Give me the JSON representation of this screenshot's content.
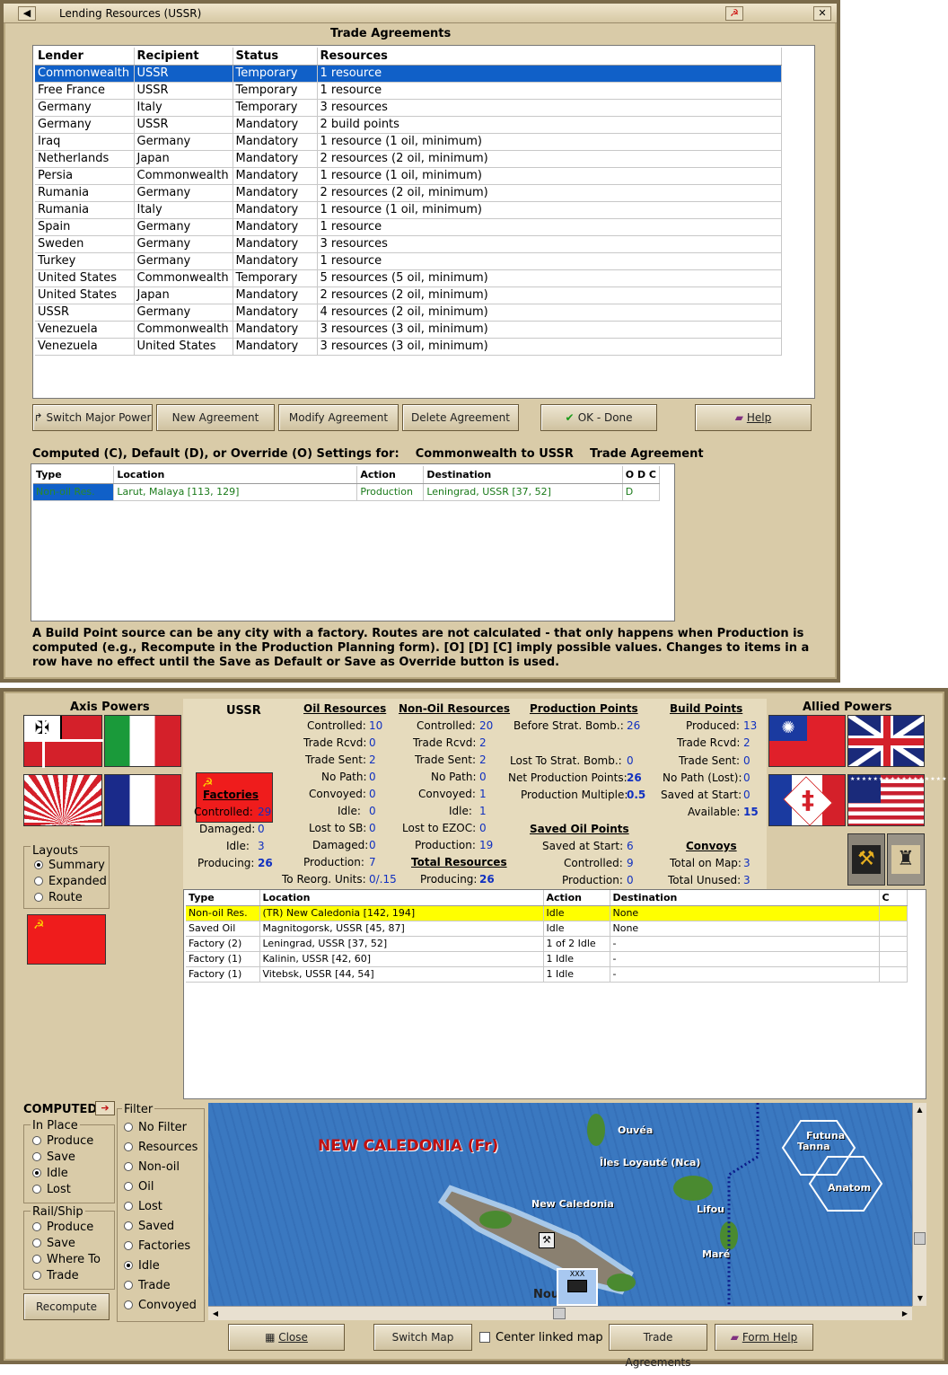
{
  "top_window": {
    "title": "Lending Resources (USSR)",
    "heading": "Trade Agreements",
    "columns": [
      "Lender",
      "Recipient",
      "Status",
      "Resources"
    ],
    "rows": [
      [
        "Commonwealth",
        "USSR",
        "Temporary",
        "1 resource"
      ],
      [
        "Free France",
        "USSR",
        "Temporary",
        "1 resource"
      ],
      [
        "Germany",
        "Italy",
        "Temporary",
        "3 resources"
      ],
      [
        "Germany",
        "USSR",
        "Mandatory",
        "2 build points"
      ],
      [
        "Iraq",
        "Germany",
        "Mandatory",
        "1 resource (1 oil, minimum)"
      ],
      [
        "Netherlands",
        "Japan",
        "Mandatory",
        "2 resources (2 oil, minimum)"
      ],
      [
        "Persia",
        "Commonwealth",
        "Mandatory",
        "1 resource (1 oil, minimum)"
      ],
      [
        "Rumania",
        "Germany",
        "Mandatory",
        "2 resources (2 oil, minimum)"
      ],
      [
        "Rumania",
        "Italy",
        "Mandatory",
        "1 resource (1 oil, minimum)"
      ],
      [
        "Spain",
        "Germany",
        "Mandatory",
        "1 resource"
      ],
      [
        "Sweden",
        "Germany",
        "Mandatory",
        "3 resources"
      ],
      [
        "Turkey",
        "Germany",
        "Mandatory",
        "1 resource"
      ],
      [
        "United States",
        "Commonwealth",
        "Temporary",
        "5 resources (5 oil, minimum)"
      ],
      [
        "United States",
        "Japan",
        "Mandatory",
        "2 resources (2 oil, minimum)"
      ],
      [
        "USSR",
        "Germany",
        "Mandatory",
        "4 resources (2 oil, minimum)"
      ],
      [
        "Venezuela",
        "Commonwealth",
        "Mandatory",
        "3 resources (3 oil, minimum)"
      ],
      [
        "Venezuela",
        "United States",
        "Mandatory",
        "3 resources (3 oil, minimum)"
      ]
    ],
    "buttons": {
      "switch": "Switch Major Power",
      "new": "New Agreement",
      "modify": "Modify Agreement",
      "delete": "Delete Agreement",
      "ok": "OK - Done",
      "help": "Help"
    },
    "settings_heading": "Computed (C), Default (D), or Override (O) Settings for:",
    "settings_subject": "Commonwealth to USSR",
    "settings_suffix": "Trade Agreement",
    "route_columns": [
      "Type",
      "Location",
      "Action",
      "Destination",
      "O D C"
    ],
    "route_row": [
      "Non-oil Res.",
      "Larut, Malaya [113, 129]",
      "Production",
      "Leningrad, USSR [37, 52]",
      "D"
    ],
    "note": "A Build Point source can be any city with a factory. Routes are not calculated - that only happens when Production is computed (e.g., Recompute in the Production Planning form).  [O] [D] [C] imply possible values.  Changes to items in a row have no effect until the Save as Default or Save as Override button is used."
  },
  "bottom_window": {
    "axis_label": "Axis Powers",
    "allied_label": "Allied Powers",
    "country": "USSR",
    "factories": {
      "title": "Factories",
      "controlled_l": "Controlled:",
      "controlled": "29",
      "damaged_l": "Damaged:",
      "damaged": "0",
      "idle_l": "Idle:",
      "idle": "3",
      "producing_l": "Producing:",
      "producing": "26"
    },
    "oil": {
      "title": "Oil Resources",
      "controlled_l": "Controlled:",
      "controlled": "10",
      "trade_rcvd_l": "Trade Rcvd:",
      "trade_rcvd": "0",
      "trade_sent_l": "Trade Sent:",
      "trade_sent": "2",
      "no_path_l": "No Path:",
      "no_path": "0",
      "convoyed_l": "Convoyed:",
      "convoyed": "0",
      "idle_l": "Idle:",
      "idle": "0",
      "lost_sb_l": "Lost to SB:",
      "lost_sb": "0",
      "damaged_l": "Damaged:",
      "damaged": "0",
      "production_l": "Production:",
      "production": "7",
      "reorg_l": "To Reorg. Units:",
      "reorg": "0/.15"
    },
    "nonoil": {
      "title": "Non-Oil Resources",
      "controlled_l": "Controlled:",
      "controlled": "20",
      "trade_rcvd_l": "Trade Rcvd:",
      "trade_rcvd": "2",
      "trade_sent_l": "Trade Sent:",
      "trade_sent": "2",
      "no_path_l": "No Path:",
      "no_path": "0",
      "convoyed_l": "Convoyed:",
      "convoyed": "1",
      "idle_l": "Idle:",
      "idle": "1",
      "lost_ezoc_l": "Lost to EZOC:",
      "lost_ezoc": "0",
      "production_l": "Production:",
      "production": "19"
    },
    "total": {
      "title": "Total Resources",
      "producing_l": "Producing:",
      "producing": "26"
    },
    "production_points": {
      "title": "Production Points",
      "before_l": "Before Strat. Bomb.:",
      "before": "26",
      "lost_l": "Lost To Strat. Bomb.:",
      "lost": "0",
      "net_l": "Net Production Points:",
      "net": "26",
      "mult_l": "Production Multiple:",
      "mult": "0.5"
    },
    "saved_oil": {
      "title": "Saved Oil Points",
      "saved_l": "Saved at Start:",
      "saved": "6",
      "controlled_l": "Controlled:",
      "controlled": "9",
      "production_l": "Production:",
      "production": "0"
    },
    "build_points": {
      "title": "Build Points",
      "produced_l": "Produced:",
      "produced": "13",
      "trade_rcvd_l": "Trade Rcvd:",
      "trade_rcvd": "2",
      "trade_sent_l": "Trade Sent:",
      "trade_sent": "0",
      "no_path_l": "No Path (Lost):",
      "no_path": "0",
      "saved_l": "Saved at Start:",
      "saved": "0",
      "available_l": "Available:",
      "available": "15"
    },
    "convoys": {
      "title": "Convoys",
      "total_l": "Total on Map:",
      "total": "3",
      "unused_l": "Total Unused:",
      "unused": "3"
    },
    "layouts": {
      "title": "Layouts",
      "options": [
        "Summary",
        "Expanded",
        "Route"
      ]
    },
    "list_columns": [
      "Type",
      "Location",
      "Action",
      "Destination",
      "C"
    ],
    "list_rows": [
      [
        "Non-oil Res.",
        "(TR) New Caledonia [142, 194]",
        "Idle",
        "None",
        ""
      ],
      [
        "Saved Oil",
        "Magnitogorsk, USSR [45, 87]",
        "Idle",
        "None",
        ""
      ],
      [
        "Factory (2)",
        "Leningrad, USSR [37, 52]",
        "1 of 2 Idle",
        "-",
        ""
      ],
      [
        "Factory (1)",
        "Kalinin, USSR [42, 60]",
        "1 Idle",
        "-",
        ""
      ],
      [
        "Factory (1)",
        "Vitebsk, USSR [44, 54]",
        "1 Idle",
        "-",
        ""
      ]
    ],
    "computed_label": "COMPUTED",
    "in_place": {
      "title": "In Place",
      "options": [
        "Produce",
        "Save",
        "Idle",
        "Lost"
      ]
    },
    "rail_ship": {
      "title": "Rail/Ship",
      "options": [
        "Produce",
        "Save",
        "Where To",
        "Trade"
      ]
    },
    "filter": {
      "title": "Filter",
      "options": [
        "No Filter",
        "Resources",
        "Non-oil",
        "Oil",
        "Lost",
        "Saved",
        "Factories",
        "Idle",
        "Trade",
        "Convoyed"
      ]
    },
    "recompute": "Recompute",
    "map": {
      "region": "NEW CALEDONIA (Fr)",
      "labels": [
        "Ouvéa",
        "Îles Loyauté (Nca)",
        "New Caledonia",
        "Lifou",
        "Maré",
        "Futuna",
        "Tanna",
        "Anatom",
        "Nou"
      ],
      "counter": "XXX"
    },
    "bottom_buttons": {
      "close": "Close",
      "switch_map": "Switch Map",
      "center": "Center linked map",
      "trade": "Trade Agreements",
      "form_help": "Form Help"
    },
    "colors": {
      "selection": "#1060c8",
      "highlight": "#ffff00",
      "sea": "#3a78c0",
      "land": "#5a8a3a"
    }
  }
}
